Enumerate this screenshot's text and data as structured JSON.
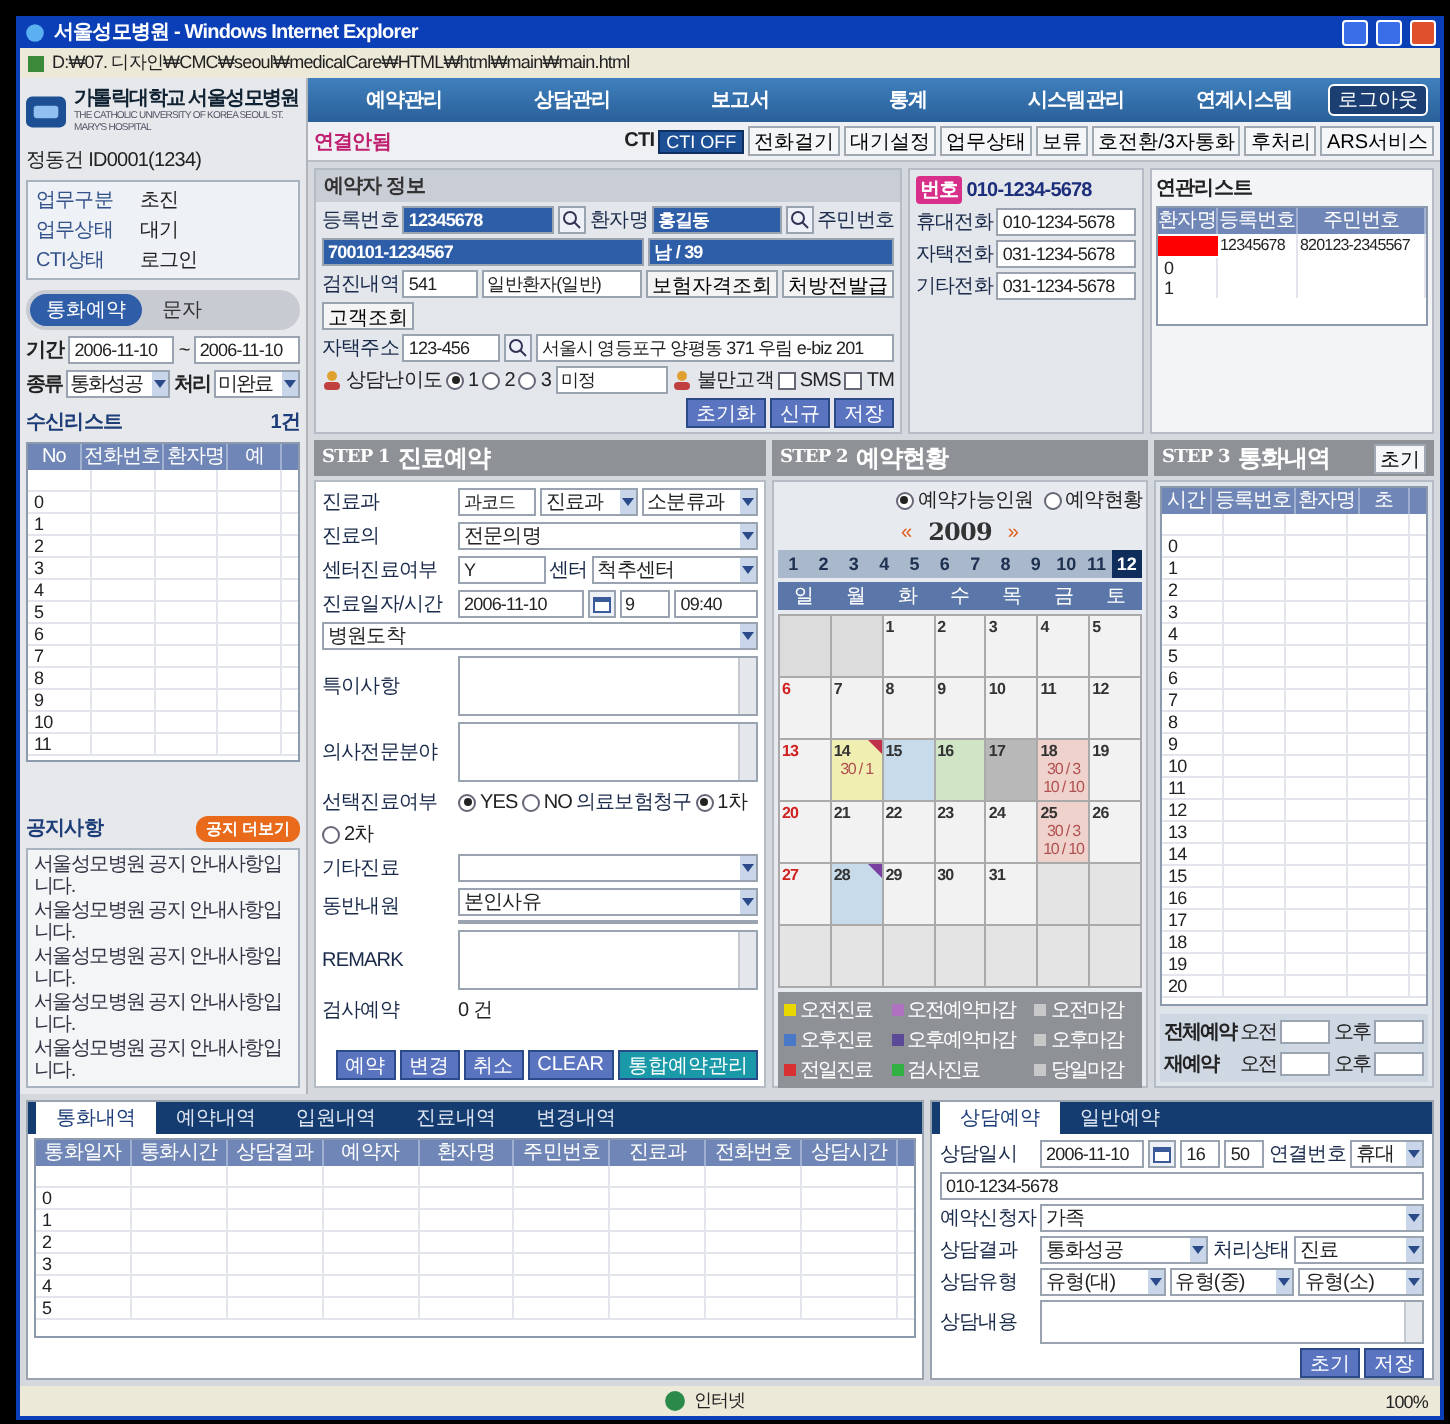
{
  "window": {
    "title": "서울성모병원 - Windows Internet Explorer",
    "address": "D:₩07. 디자인₩CMC₩seoul₩medicalCare₩HTML₩html₩main₩main.html"
  },
  "sidebar": {
    "logo": "가톨릭대학교 서울성모병원",
    "logo_sub": "THE CATHOLIC UNIVERSITY OF KOREA SEOUL ST. MARY'S HOSPITAL",
    "user": "정동건 ID0001(1234)",
    "status": [
      {
        "label": "업무구분",
        "value": "초진"
      },
      {
        "label": "업무상태",
        "value": "대기"
      },
      {
        "label": "CTI상태",
        "value": "로그인"
      }
    ],
    "tabs": [
      {
        "label": "통화예약",
        "selected": true
      },
      {
        "label": "문자",
        "selected": false
      }
    ],
    "period": {
      "label": "기간",
      "from": "2006-11-10",
      "sep": "~",
      "to": "2006-11-10"
    },
    "filters": [
      {
        "label": "종류",
        "value": "통화성공"
      },
      {
        "label": "처리",
        "value": "미완료"
      }
    ],
    "list": {
      "title": "수신리스트",
      "count": "1건",
      "columns": [
        "No",
        "전화번호",
        "환자명",
        "예"
      ],
      "rows": [
        "0",
        "1",
        "2",
        "3",
        "4",
        "5",
        "6",
        "7",
        "8",
        "9",
        "10",
        "11"
      ]
    },
    "notice": {
      "title": "공지사항",
      "button": "공지 더보기",
      "items": [
        "서울성모병원 공지 안내사항입니다.",
        "서울성모병원 공지 안내사항입니다.",
        "서울성모병원 공지 안내사항입니다.",
        "서울성모병원 공지 안내사항입니다.",
        "서울성모병원 공지 안내사항입니다."
      ]
    }
  },
  "nav": {
    "items": [
      "예약관리",
      "상담관리",
      "보고서",
      "통계",
      "시스템관리",
      "연계시스템"
    ],
    "logout": "로그아웃"
  },
  "toolbar": {
    "status": "연결안됨",
    "cti_label": "CTI",
    "cti_button": "CTI OFF",
    "buttons": [
      "전화걸기",
      "대기설정",
      "업무상태",
      "보류",
      "호전환/3자통화",
      "후처리"
    ],
    "ars": "ARS서비스"
  },
  "patient": {
    "title": "예약자 정보",
    "phone_badge": "번호",
    "phone": "010-1234-5678",
    "rows": [
      {
        "items": [
          {
            "kind": "label",
            "text": "등록번호"
          },
          {
            "kind": "input",
            "value": "12345678",
            "highlight": true
          },
          {
            "kind": "search"
          },
          {
            "kind": "label",
            "text": "환자명"
          },
          {
            "kind": "input",
            "value": "홍길동",
            "highlight": true
          },
          {
            "kind": "search"
          },
          {
            "kind": "label",
            "text": "주민번호"
          },
          {
            "kind": "input",
            "value": "700101-1234567",
            "highlight": true
          },
          {
            "kind": "input",
            "value": "남 / 39",
            "highlight": true
          }
        ]
      },
      {
        "items": [
          {
            "kind": "label",
            "text": "검진내역"
          },
          {
            "kind": "input",
            "value": "541"
          },
          {
            "kind": "input",
            "value": "일반환자(일반)"
          },
          {
            "kind": "button",
            "text": "보험자격조회"
          },
          {
            "kind": "button",
            "text": "처방전발급"
          },
          {
            "kind": "button",
            "text": "고객조회"
          }
        ]
      },
      {
        "items": [
          {
            "kind": "label",
            "text": "자택주소"
          },
          {
            "kind": "input",
            "value": "123-456"
          },
          {
            "kind": "search"
          },
          {
            "kind": "input",
            "value": "서울시 영등포구 양평동 371 우림 e-biz 201"
          }
        ]
      },
      {
        "items": [
          {
            "kind": "icon_label",
            "text": "상담난이도"
          },
          {
            "kind": "radio",
            "text": "1",
            "selected": true
          },
          {
            "kind": "radio",
            "text": "2",
            "selected": false
          },
          {
            "kind": "radio",
            "text": "3",
            "selected": false
          },
          {
            "kind": "input",
            "value": "미정"
          },
          {
            "kind": "icon_label",
            "text": "불만고객"
          },
          {
            "kind": "check",
            "text": "SMS",
            "checked": false
          },
          {
            "kind": "check",
            "text": "TM",
            "checked": false
          }
        ]
      }
    ],
    "buttons": [
      "초기화",
      "신규",
      "저장"
    ],
    "phones": [
      {
        "label": "휴대전화",
        "value": "010-1234-5678"
      },
      {
        "label": "자택전화",
        "value": "031-1234-5678"
      },
      {
        "label": "기타전화",
        "value": "031-1234-5678"
      }
    ]
  },
  "related": {
    "title": "연관리스트",
    "columns": [
      "환자명",
      "등록번호",
      "주민번호"
    ],
    "rows": [
      {
        "redacted": true,
        "cells": [
          "12345678",
          "820123-2345567"
        ]
      },
      {
        "redacted": false,
        "index": "0"
      },
      {
        "redacted": false,
        "index": "1"
      }
    ]
  },
  "step1": {
    "step": "STEP 1",
    "title": "진료예약",
    "rows": [
      {
        "items": [
          {
            "kind": "label",
            "text": "진료과"
          },
          {
            "kind": "input",
            "value": "과코드"
          },
          {
            "kind": "select",
            "value": "진료과"
          },
          {
            "kind": "select",
            "value": "소분류과"
          }
        ]
      },
      {
        "items": [
          {
            "kind": "label",
            "text": "진료의"
          },
          {
            "kind": "select",
            "value": "전문의명"
          }
        ]
      },
      {
        "items": [
          {
            "kind": "label",
            "text": "센터진료여부"
          },
          {
            "kind": "input",
            "value": "Y"
          },
          {
            "kind": "label",
            "text": "센터"
          },
          {
            "kind": "select",
            "value": "척추센터"
          }
        ]
      },
      {
        "items": [
          {
            "kind": "label",
            "text": "진료일자/시간"
          },
          {
            "kind": "input",
            "value": "2006-11-10"
          },
          {
            "kind": "date"
          },
          {
            "kind": "input",
            "value": "9"
          },
          {
            "kind": "input",
            "value": "09:40"
          },
          {
            "kind": "select",
            "value": "병원도착"
          }
        ]
      },
      {
        "items": [
          {
            "kind": "label",
            "text": "특이사항"
          },
          {
            "kind": "area"
          }
        ]
      },
      {
        "items": [
          {
            "kind": "label",
            "text": "의사전문분야"
          },
          {
            "kind": "area"
          }
        ]
      },
      {
        "items": [
          {
            "kind": "label",
            "text": "선택진료여부"
          },
          {
            "kind": "radio",
            "text": "YES",
            "selected": true
          },
          {
            "kind": "radio",
            "text": "NO",
            "selected": false
          },
          {
            "kind": "label",
            "text": "의료보험청구"
          },
          {
            "kind": "radio",
            "text": "1차",
            "selected": true
          },
          {
            "kind": "radio",
            "text": "2차",
            "selected": false
          }
        ]
      },
      {
        "items": [
          {
            "kind": "label",
            "text": "기타진료"
          },
          {
            "kind": "select"
          }
        ]
      },
      {
        "items": [
          {
            "kind": "label",
            "text": "동반내원"
          },
          {
            "kind": "select_area",
            "value": "본인사유"
          }
        ]
      },
      {
        "items": [
          {
            "kind": "label",
            "text": "REMARK"
          },
          {
            "kind": "area"
          }
        ]
      },
      {
        "items": [
          {
            "kind": "label",
            "text": "검사예약"
          },
          {
            "kind": "text",
            "text": "0 건"
          }
        ]
      }
    ],
    "buttons": [
      {
        "text": "예약",
        "kind": "normal"
      },
      {
        "text": "변경",
        "kind": "normal"
      },
      {
        "text": "취소",
        "kind": "normal"
      },
      {
        "text": "CLEAR",
        "kind": "normal"
      },
      {
        "text": "통합예약관리",
        "kind": "accent"
      }
    ]
  },
  "step2": {
    "step": "STEP 2",
    "title": "예약현황",
    "radios": [
      {
        "label": "예약가능인원",
        "selected": true
      },
      {
        "label": "예약현황",
        "selected": false
      }
    ],
    "calendar": {
      "prev": "«",
      "year": "2009",
      "next": "»",
      "months": [
        {
          "label": "1",
          "selected": false
        },
        {
          "label": "2",
          "selected": false
        },
        {
          "label": "3",
          "selected": false
        },
        {
          "label": "4",
          "selected": false
        },
        {
          "label": "5",
          "selected": false
        },
        {
          "label": "6",
          "selected": false
        },
        {
          "label": "7",
          "selected": false
        },
        {
          "label": "8",
          "selected": false
        },
        {
          "label": "9",
          "selected": false
        },
        {
          "label": "10",
          "selected": false
        },
        {
          "label": "11",
          "selected": false
        },
        {
          "label": "12",
          "selected": true
        }
      ],
      "weekdays": [
        "일",
        "월",
        "화",
        "수",
        "목",
        "금",
        "토"
      ],
      "weeks": [
        [
          {
            "color": "#dcdcdc"
          },
          {
            "color": "#dcdcdc"
          },
          {
            "day": "1"
          },
          {
            "day": "2"
          },
          {
            "day": "3"
          },
          {
            "day": "4"
          },
          {
            "day": "5"
          }
        ],
        [
          {
            "day": "6"
          },
          {
            "day": "7"
          },
          {
            "day": "8"
          },
          {
            "day": "9"
          },
          {
            "day": "10"
          },
          {
            "day": "11"
          },
          {
            "day": "12"
          }
        ],
        [
          {
            "day": "13"
          },
          {
            "day": "14",
            "color": "#f1eeb2",
            "lines": [
              "30 / 1"
            ],
            "marker": {
              "color": "#c0304a"
            }
          },
          {
            "day": "15",
            "color": "#c7dbeb"
          },
          {
            "day": "16",
            "color": "#cfe5c6"
          },
          {
            "day": "17",
            "color": "#b8b8b8"
          },
          {
            "day": "18",
            "color": "#f0d2cc",
            "lines": [
              "30 / 3",
              "10 / 10"
            ]
          },
          {
            "day": "19"
          }
        ],
        [
          {
            "day": "20"
          },
          {
            "day": "21"
          },
          {
            "day": "22"
          },
          {
            "day": "23"
          },
          {
            "day": "24"
          },
          {
            "day": "25",
            "color": "#f0d2cc",
            "lines": [
              "30 / 3",
              "10 / 10"
            ]
          },
          {
            "day": "26"
          }
        ],
        [
          {
            "day": "27"
          },
          {
            "day": "28",
            "color": "#c7dbeb",
            "marker": {
              "color": "#7a3fa0"
            }
          },
          {
            "day": "29"
          },
          {
            "day": "30"
          },
          {
            "day": "31"
          },
          {
            "color": "#e4e4e4"
          },
          {
            "color": "#e4e4e4"
          }
        ],
        [
          {
            "color": "#e4e4e4"
          },
          {
            "color": "#e4e4e4"
          },
          {
            "color": "#e4e4e4"
          },
          {
            "color": "#e4e4e4"
          },
          {
            "color": "#e4e4e4"
          },
          {
            "color": "#e4e4e4"
          },
          {
            "color": "#e4e4e4"
          }
        ]
      ]
    },
    "legend": [
      {
        "label": "오전진료",
        "color": "#e8d800"
      },
      {
        "label": "오전예약마감",
        "color": "#b070c0"
      },
      {
        "label": "오전마감",
        "color": "#c8c8c8"
      },
      {
        "label": "오후진료",
        "color": "#4a78c8"
      },
      {
        "label": "오후예약마감",
        "color": "#5a4a98"
      },
      {
        "label": "오후마감",
        "color": "#c8c8c8"
      },
      {
        "label": "전일진료",
        "color": "#d83030"
      },
      {
        "label": "검사진료",
        "color": "#30b040"
      },
      {
        "label": "당일마감",
        "color": "#c8c8c8"
      }
    ]
  },
  "step3": {
    "step": "STEP 3",
    "title": "통화내역",
    "reset": "초기",
    "columns": [
      "시간",
      "등록번호",
      "환자명",
      "초"
    ],
    "rows": [
      "0",
      "1",
      "2",
      "3",
      "4",
      "5",
      "6",
      "7",
      "8",
      "9",
      "10",
      "11",
      "12",
      "13",
      "14",
      "15",
      "16",
      "17",
      "18",
      "19",
      "20"
    ],
    "summary": [
      {
        "label": "전체예약",
        "am": "오전",
        "pm": "오후"
      },
      {
        "label": "재예약",
        "am": "오전",
        "pm": "오후"
      }
    ]
  },
  "history": {
    "tabs": [
      {
        "label": "통화내역",
        "selected": true
      },
      {
        "label": "예약내역",
        "selected": false
      },
      {
        "label": "입원내역",
        "selected": false
      },
      {
        "label": "진료내역",
        "selected": false
      },
      {
        "label": "변경내역",
        "selected": false
      }
    ],
    "columns": [
      "통화일자",
      "통화시간",
      "상담결과",
      "예약자",
      "환자명",
      "주민번호",
      "진료과",
      "전화번호",
      "상담시간"
    ],
    "rows": [
      "0",
      "1",
      "2",
      "3",
      "4",
      "5"
    ]
  },
  "consult": {
    "tabs": [
      {
        "label": "상담예약",
        "selected": true
      },
      {
        "label": "일반예약",
        "selected": false
      }
    ],
    "rows": [
      {
        "items": [
          {
            "kind": "label",
            "text": "상담일시"
          },
          {
            "kind": "input",
            "value": "2006-11-10"
          },
          {
            "kind": "date"
          },
          {
            "kind": "input",
            "value": "16"
          },
          {
            "kind": "input",
            "value": "50"
          },
          {
            "kind": "label",
            "text": "연결번호"
          },
          {
            "kind": "select",
            "value": "휴대"
          },
          {
            "kind": "input",
            "value": "010-1234-5678"
          }
        ]
      },
      {
        "items": [
          {
            "kind": "label",
            "text": "예약신청자"
          },
          {
            "kind": "select",
            "value": "가족"
          }
        ]
      },
      {
        "items": [
          {
            "kind": "label",
            "text": "상담결과"
          },
          {
            "kind": "select",
            "value": "통화성공"
          },
          {
            "kind": "label",
            "text": "처리상태"
          },
          {
            "kind": "select",
            "value": "진료"
          }
        ]
      },
      {
        "items": [
          {
            "kind": "label",
            "text": "상담유형"
          },
          {
            "kind": "select",
            "value": "유형(대)"
          },
          {
            "kind": "select",
            "value": "유형(중)"
          },
          {
            "kind": "select",
            "value": "유형(소)"
          }
        ]
      },
      {
        "items": [
          {
            "kind": "label",
            "text": "상담내용"
          },
          {
            "kind": "area"
          }
        ]
      }
    ],
    "buttons": [
      "초기",
      "저장"
    ]
  },
  "status_bar": {
    "zone": "인터넷",
    "zoom": "100%"
  }
}
